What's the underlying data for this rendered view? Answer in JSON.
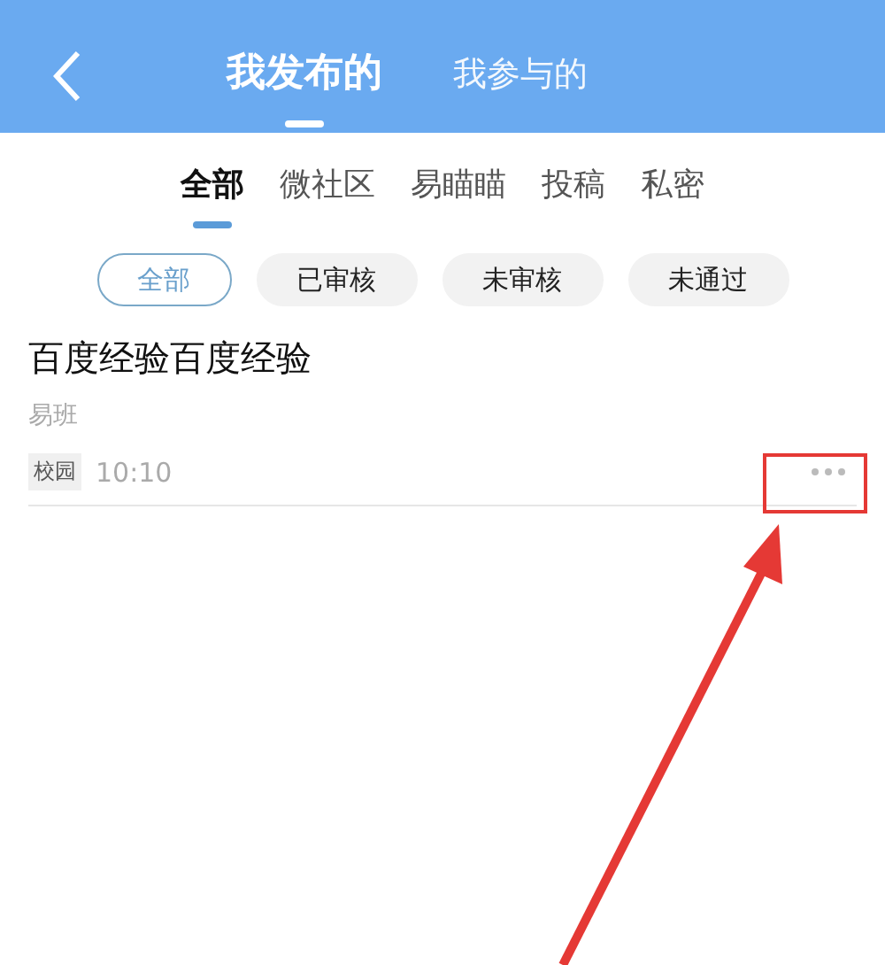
{
  "header": {
    "tabs": [
      {
        "label": "我发布的",
        "selected": true
      },
      {
        "label": "我参与的",
        "selected": false
      }
    ]
  },
  "categories": [
    {
      "label": "全部",
      "selected": true
    },
    {
      "label": "微社区",
      "selected": false
    },
    {
      "label": "易瞄瞄",
      "selected": false
    },
    {
      "label": "投稿",
      "selected": false
    },
    {
      "label": "私密",
      "selected": false
    }
  ],
  "filters": [
    {
      "label": "全部",
      "selected": true
    },
    {
      "label": "已审核",
      "selected": false
    },
    {
      "label": "未审核",
      "selected": false
    },
    {
      "label": "未通过",
      "selected": false
    }
  ],
  "posts": [
    {
      "title": "百度经验百度经验",
      "source": "易班",
      "tag": "校园",
      "time": "10:10"
    }
  ]
}
